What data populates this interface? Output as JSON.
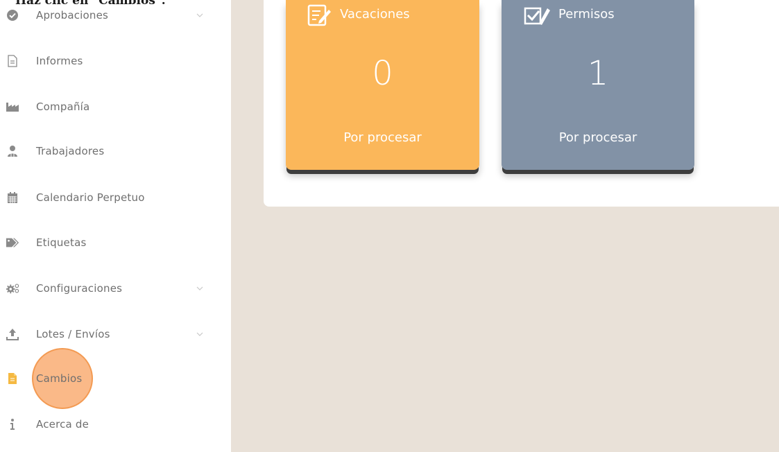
{
  "caption": {
    "text": "Haz clic en \"Cambios\"."
  },
  "sidebar": {
    "items": [
      {
        "label": "Aprobaciones",
        "icon": "check-circle-icon",
        "has_chevron": true
      },
      {
        "label": "Informes",
        "icon": "document-icon",
        "has_chevron": false
      },
      {
        "label": "Compañía",
        "icon": "factory-icon",
        "has_chevron": false
      },
      {
        "label": "Trabajadores",
        "icon": "user-icon",
        "has_chevron": false
      },
      {
        "label": "Calendario Perpetuo",
        "icon": "calendar-icon",
        "has_chevron": false
      },
      {
        "label": "Etiquetas",
        "icon": "tags-icon",
        "has_chevron": false
      },
      {
        "label": "Configuraciones",
        "icon": "gears-icon",
        "has_chevron": true
      },
      {
        "label": "Lotes / Envíos",
        "icon": "upload-icon",
        "has_chevron": true
      },
      {
        "label": "Cambios",
        "icon": "file-icon",
        "has_chevron": false,
        "highlighted": true
      },
      {
        "label": "Acerca de",
        "icon": "info-icon",
        "has_chevron": false
      }
    ]
  },
  "cards": {
    "vacaciones": {
      "title": "Vacaciones",
      "count": "0",
      "subtitle": "Por procesar",
      "color": "#fbb75a"
    },
    "permisos": {
      "title": "Permisos",
      "count": "1",
      "subtitle": "Por procesar",
      "color": "#8292a6"
    }
  },
  "colors": {
    "highlight": "#f9aa6e",
    "main_bg": "#e9e1d8",
    "active_icon": "#f5b942"
  }
}
